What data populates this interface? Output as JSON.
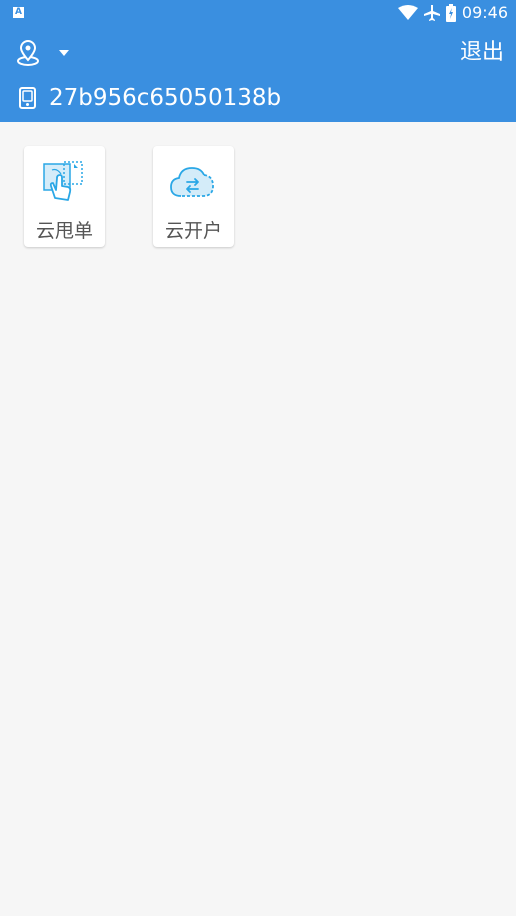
{
  "status_bar": {
    "notification_badge": "A",
    "time": "09:46",
    "icons": [
      "wifi-icon",
      "airplane-icon",
      "battery-icon"
    ]
  },
  "toolbar": {
    "location_icon": "location-pin-icon",
    "dropdown_icon": "dropdown-arrow-icon",
    "logout_label": "退出"
  },
  "device": {
    "icon": "device-icon",
    "id": "27b956c65050138b"
  },
  "apps": [
    {
      "label": "云甩单",
      "icon": "hand-tap-icon"
    },
    {
      "label": "云开户",
      "icon": "cloud-transfer-icon"
    }
  ],
  "colors": {
    "header": "#3a8fe0",
    "background": "#f6f6f6",
    "tile": "#ffffff",
    "label": "#555555",
    "icon_accent": "#2aa7e6"
  }
}
